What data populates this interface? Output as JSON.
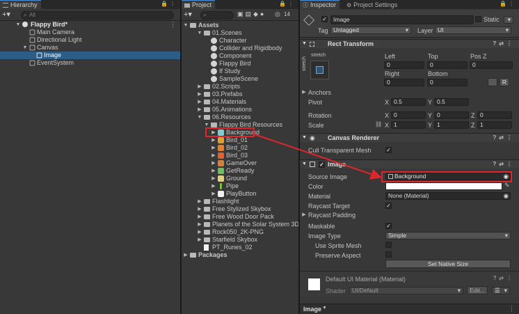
{
  "hierarchy": {
    "tab_label": "Hierarchy",
    "search_placeholder": "All",
    "scene_name": "Flappy Bird*",
    "items": [
      {
        "label": "Main Camera"
      },
      {
        "label": "Directional Light"
      },
      {
        "label": "Canvas"
      },
      {
        "label": "Image"
      },
      {
        "label": "EventSystem"
      }
    ]
  },
  "project": {
    "tab_label": "Project",
    "badge_count": "14",
    "assets_root": "Assets",
    "items": [
      {
        "label": "01.Scenes"
      },
      {
        "label": "Character"
      },
      {
        "label": "Collider and Rigidbody"
      },
      {
        "label": "Component"
      },
      {
        "label": "Flappy Bird"
      },
      {
        "label": "If Study"
      },
      {
        "label": "SampleScene"
      },
      {
        "label": "02.Scripts"
      },
      {
        "label": "03.Prefabs"
      },
      {
        "label": "04.Materials"
      },
      {
        "label": "05.Animations"
      },
      {
        "label": "06.Resources"
      },
      {
        "label": "Flappy Bird Resources"
      },
      {
        "label": "Background"
      },
      {
        "label": "Bird_01"
      },
      {
        "label": "Bird_02"
      },
      {
        "label": "Bird_03"
      },
      {
        "label": "GameOver"
      },
      {
        "label": "GetReady"
      },
      {
        "label": "Ground"
      },
      {
        "label": "Pipe"
      },
      {
        "label": "PlayButton"
      },
      {
        "label": "Flashlight"
      },
      {
        "label": "Free Stylized Skybox"
      },
      {
        "label": "Free Wood Door Pack"
      },
      {
        "label": "Planets of the Solar System 3D"
      },
      {
        "label": "Rock050_2K-PNG"
      },
      {
        "label": "Starfield Skybox"
      },
      {
        "label": "PT_Runes_02"
      },
      {
        "label": "Packages"
      }
    ]
  },
  "inspector": {
    "tab_label": "Inspector",
    "settings_tab_label": "Project Settings",
    "object_name": "Image",
    "static_label": "Static",
    "tag_label": "Tag",
    "tag_value": "Untagged",
    "layer_label": "Layer",
    "layer_value": "UI",
    "rect_transform": {
      "title": "Rect Transform",
      "anchor_preset": "stretch",
      "anchor_preset_side": "stretch",
      "left_label": "Left",
      "left_value": "0",
      "top_label": "Top",
      "top_value": "0",
      "posz_label": "Pos Z",
      "posz_value": "0",
      "right_label": "Right",
      "right_value": "0",
      "bottom_label": "Bottom",
      "bottom_value": "0",
      "r_button": "R",
      "anchors_label": "Anchors",
      "pivot_label": "Pivot",
      "pivot_x": "0.5",
      "pivot_y": "0.5",
      "rotation_label": "Rotation",
      "rot_x": "0",
      "rot_y": "0",
      "rot_z": "0",
      "scale_label": "Scale",
      "scale_x": "1",
      "scale_y": "1",
      "scale_z": "1",
      "x": "X",
      "y": "Y",
      "z": "Z"
    },
    "canvas_renderer": {
      "title": "Canvas Renderer",
      "cull_label": "Cull Transparent Mesh"
    },
    "image": {
      "title": "Image",
      "source_image_label": "Source Image",
      "source_image_value": "Background",
      "color_label": "Color",
      "material_label": "Material",
      "material_value": "None (Material)",
      "raycast_target_label": "Raycast Target",
      "raycast_padding_label": "Raycast Padding",
      "maskable_label": "Maskable",
      "image_type_label": "Image Type",
      "image_type_value": "Simple",
      "use_sprite_mesh_label": "Use Sprite Mesh",
      "preserve_aspect_label": "Preserve Aspect",
      "set_native_size_label": "Set Native Size"
    },
    "material": {
      "title": "Default UI Material (Material)",
      "shader_label": "Shader",
      "shader_value": "UI/Default",
      "edit_label": "Edit..."
    },
    "footer_label": "Image"
  },
  "colors": {
    "selection": "#2c5d87",
    "annotation_red": "#e0252b",
    "panel_bg": "#383838"
  }
}
